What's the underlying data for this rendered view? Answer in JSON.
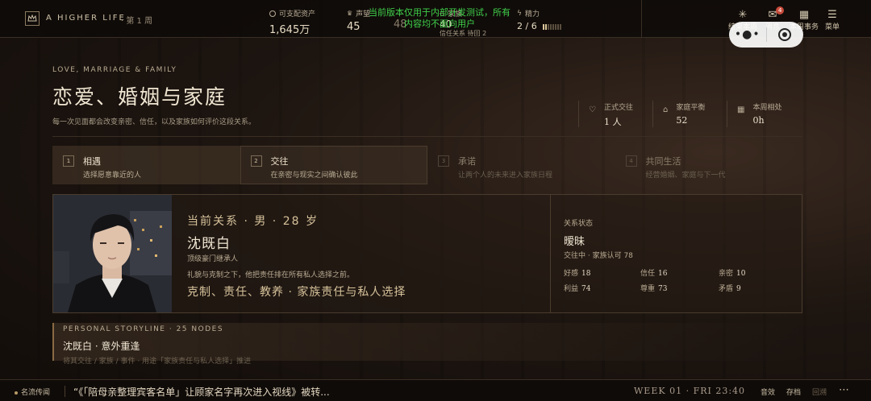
{
  "topbar": {
    "brand": "A HIGHER LIFE",
    "week": "· 第 1 周",
    "stats": {
      "money_label": "可支配资产",
      "money_value": "1,645万",
      "fame_label": "声望",
      "fame_value": "45",
      "stat3_value": "48",
      "family_label": "家族",
      "family_value": "40",
      "family_sub": "信任关系  待回 2",
      "energy_label": "精力",
      "energy_value": "2 / 6"
    },
    "dev_notice": "当前版本仅用于内部开发测试，所有内容均不面向用户",
    "nav": {
      "end_week": "结束本周",
      "messages": "消息",
      "messages_badge": "4",
      "week_affairs": "本周事务",
      "menu": "菜单"
    }
  },
  "header": {
    "eyebrow": "LOVE, MARRIAGE & FAMILY",
    "title": "恋爱、婚姻与家庭",
    "subtitle": "每一次见面都会改变亲密、信任，以及家族如何评价这段关系。",
    "stats": [
      {
        "label": "正式交往",
        "value": "1 人"
      },
      {
        "label": "家庭平衡",
        "value": "52"
      },
      {
        "label": "本周相处",
        "value": "0h"
      }
    ]
  },
  "steps": [
    {
      "num": "1",
      "name": "相遇",
      "desc": "选择愿意靠近的人"
    },
    {
      "num": "2",
      "name": "交往",
      "desc": "在亲密与现实之间确认彼此"
    },
    {
      "num": "3",
      "name": "承诺",
      "desc": "让两个人的未来进入家族日程"
    },
    {
      "num": "4",
      "name": "共同生活",
      "desc": "经营婚姻、家庭与下一代"
    }
  ],
  "partner": {
    "meta": "当前关系 · 男 · 28 岁",
    "name": "沈既白",
    "role": "顶级豪门继承人",
    "desc": "礼貌与克制之下，他把责任排在所有私人选择之前。",
    "traits": "克制、责任、教养  ·  家族责任与私人选择",
    "status_label": "关系状态",
    "status_value": "暧昧",
    "status_sub": "交往中 · 家族认可 78",
    "attrs": [
      {
        "label": "好感",
        "value": "18"
      },
      {
        "label": "信任",
        "value": "16"
      },
      {
        "label": "亲密",
        "value": "10"
      },
      {
        "label": "利益",
        "value": "74"
      },
      {
        "label": "尊重",
        "value": "73"
      },
      {
        "label": "矛盾",
        "value": "9"
      }
    ]
  },
  "story": {
    "label": "PERSONAL STORYLINE · 25 NODES",
    "title": "沈既白 · 意外重逢",
    "sub": "将其交往 / 家族 / 事件 · 用途「家族责任与私人选择」推进"
  },
  "bottom": {
    "rumor_label": "名流传闻",
    "ticker": "“《「陪母亲整理宾客名单」让顾家名字再次进入视线》被转...",
    "clock": "WEEK 01 · FRI  23:40",
    "sound": "音效",
    "save": "存档",
    "back": "回溯",
    "more": "⋯"
  },
  "colors": {
    "accent": "#d6c29a",
    "background": "#16100c",
    "dev_notice": "#3fd04a",
    "badge": "#c84a3a"
  }
}
